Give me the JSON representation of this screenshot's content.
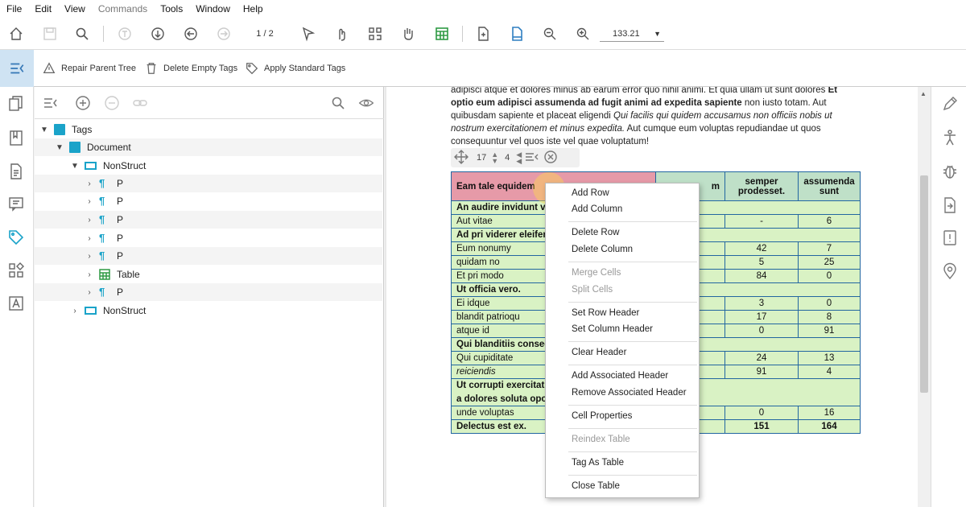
{
  "menubar": [
    "File",
    "Edit",
    "View",
    "Commands",
    "Tools",
    "Window",
    "Help"
  ],
  "toolbar": {
    "page": "1 / 2",
    "zoom": "133.21"
  },
  "tagbar": {
    "repair": "Repair Parent Tree",
    "delete_empty": "Delete Empty Tags",
    "apply_standard": "Apply Standard Tags"
  },
  "tree": [
    {
      "label": "Tags"
    },
    {
      "label": "Document"
    },
    {
      "label": "NonStruct"
    },
    {
      "label": "P"
    },
    {
      "label": "P"
    },
    {
      "label": "P"
    },
    {
      "label": "P"
    },
    {
      "label": "P"
    },
    {
      "label": "Table"
    },
    {
      "label": "P"
    },
    {
      "label": "NonStruct"
    }
  ],
  "doc": {
    "line1": "adipisci atque et dolores minus ab earum error quo nihil animi. Et quia ullam ut sunt dolores",
    "line1_bold": "Et",
    "line2_bold": "optio eum adipisci assumenda ad fugit animi ad expedita sapiente",
    "line2_rest": "non iusto totam. Aut",
    "line3_a": "quibusdam sapiente et placeat eligendi",
    "line3_i": "Qui facilis qui quidem accusamus non officiis nobis ut",
    "line4_i": "nostrum exercitationem et minus expedita.",
    "line4_rest": "Aut cumque eum voluptas repudiandae ut quos",
    "line5": "consequuntur vel quos iste vel quae voluptatum!",
    "cell_row": "17",
    "cell_col": "4"
  },
  "table": {
    "header": [
      "Eam tale equidem",
      "m",
      "semper prodesset.",
      "assumenda sunt"
    ],
    "rows": [
      {
        "c": [
          "An audire invidunt vi",
          "",
          "",
          ""
        ],
        "style": "bold"
      },
      {
        "c": [
          "Aut vitae",
          "",
          "-",
          "6"
        ]
      },
      {
        "c": [
          "Ad pri viderer eleifer",
          "",
          "",
          ""
        ],
        "style": "bold"
      },
      {
        "c": [
          "Eum nonumy",
          "",
          "42",
          "7"
        ]
      },
      {
        "c": [
          "quidam no",
          "",
          "5",
          "25"
        ]
      },
      {
        "c": [
          "Et pri modo",
          "",
          "84",
          "0"
        ]
      },
      {
        "c": [
          "Ut officia vero.",
          "",
          "",
          ""
        ],
        "style": "bold"
      },
      {
        "c": [
          "Ei idque",
          "",
          "3",
          "0"
        ]
      },
      {
        "c": [
          "blandit patrioqu",
          "",
          "17",
          "8"
        ]
      },
      {
        "c": [
          "atque id",
          "",
          "0",
          "91"
        ]
      },
      {
        "c": [
          "Qui blanditiis conseq",
          "",
          "",
          ""
        ],
        "style": "bold"
      },
      {
        "c": [
          "Qui cupiditate",
          "",
          "24",
          "13"
        ]
      },
      {
        "c": [
          "reiciendis",
          "",
          "91",
          "4"
        ],
        "style": "ital"
      },
      {
        "c": [
          "Ut corrupti exercitati",
          "",
          "",
          ""
        ],
        "style": "bold"
      },
      {
        "c": [
          "a dolores soluta opor",
          "",
          "",
          ""
        ],
        "style": "bold"
      },
      {
        "c": [
          "unde voluptas",
          "",
          "0",
          "16"
        ]
      },
      {
        "c": [
          "Delectus est ex.",
          "",
          "151",
          "164"
        ],
        "style": "bold"
      }
    ]
  },
  "context_menu": {
    "add_row": "Add Row",
    "add_column": "Add Column",
    "delete_row": "Delete Row",
    "delete_column": "Delete Column",
    "merge_cells": "Merge Cells",
    "split_cells": "Split Cells",
    "set_row_header": "Set Row Header",
    "set_column_header": "Set Column Header",
    "clear_header": "Clear Header",
    "add_associated_header": "Add Associated Header",
    "remove_associated_header": "Remove Associated Header",
    "cell_properties": "Cell Properties",
    "reindex_table": "Reindex Table",
    "tag_as_table": "Tag As Table",
    "close_table": "Close Table"
  },
  "colors": {
    "accent": "#3477b6",
    "tag_icon": "#1aa3c9",
    "table_cell": "#d9f2c4",
    "header_cell": "#bfe0c8",
    "selected_header": "#e69aa8",
    "table_border": "#2266a0"
  }
}
